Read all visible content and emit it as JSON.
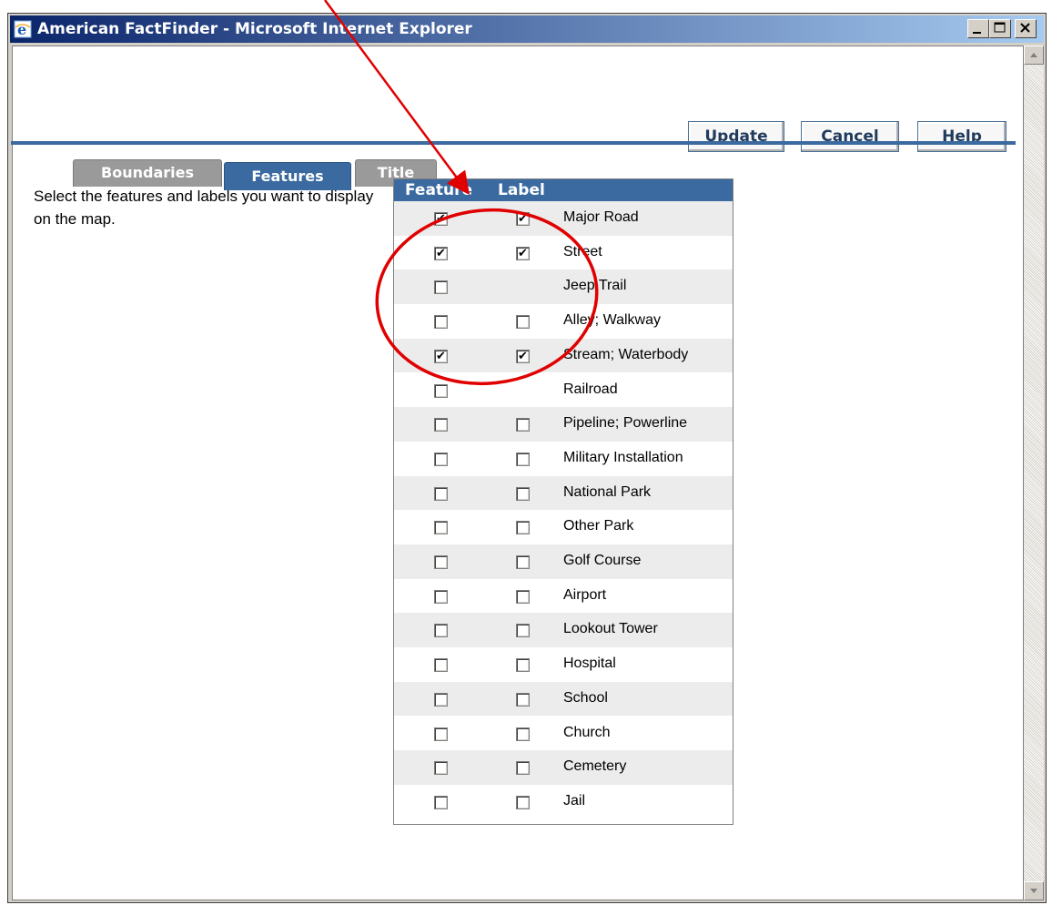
{
  "window": {
    "title": "American FactFinder - Microsoft Internet Explorer"
  },
  "actions": {
    "update_label": "Update",
    "cancel_label": "Cancel",
    "help_label": "Help"
  },
  "tabs": [
    {
      "label": "Boundaries",
      "active": false
    },
    {
      "label": "Features",
      "active": true
    },
    {
      "label": "Title",
      "active": false
    }
  ],
  "instructions": "Select the features and labels you want to display on the map.",
  "features_table": {
    "headers": {
      "feature": "Feature",
      "label": "Label"
    },
    "rows": [
      {
        "name": "Major Road",
        "feature": true,
        "label": true,
        "has_label": true
      },
      {
        "name": "Street",
        "feature": true,
        "label": true,
        "has_label": true
      },
      {
        "name": "Jeep Trail",
        "feature": false,
        "label": false,
        "has_label": false
      },
      {
        "name": "Alley; Walkway",
        "feature": false,
        "label": false,
        "has_label": true
      },
      {
        "name": "Stream; Waterbody",
        "feature": true,
        "label": true,
        "has_label": true
      },
      {
        "name": "Railroad",
        "feature": false,
        "label": false,
        "has_label": false
      },
      {
        "name": "Pipeline; Powerline",
        "feature": false,
        "label": false,
        "has_label": true
      },
      {
        "name": "Military Installation",
        "feature": false,
        "label": false,
        "has_label": true
      },
      {
        "name": "National Park",
        "feature": false,
        "label": false,
        "has_label": true
      },
      {
        "name": "Other Park",
        "feature": false,
        "label": false,
        "has_label": true
      },
      {
        "name": "Golf Course",
        "feature": false,
        "label": false,
        "has_label": true
      },
      {
        "name": "Airport",
        "feature": false,
        "label": false,
        "has_label": true
      },
      {
        "name": "Lookout Tower",
        "feature": false,
        "label": false,
        "has_label": true
      },
      {
        "name": "Hospital",
        "feature": false,
        "label": false,
        "has_label": true
      },
      {
        "name": "School",
        "feature": false,
        "label": false,
        "has_label": true
      },
      {
        "name": "Church",
        "feature": false,
        "label": false,
        "has_label": true
      },
      {
        "name": "Cemetery",
        "feature": false,
        "label": false,
        "has_label": true
      },
      {
        "name": "Jail",
        "feature": false,
        "label": false,
        "has_label": true
      }
    ]
  },
  "annotation": {
    "color": "#e00000"
  }
}
